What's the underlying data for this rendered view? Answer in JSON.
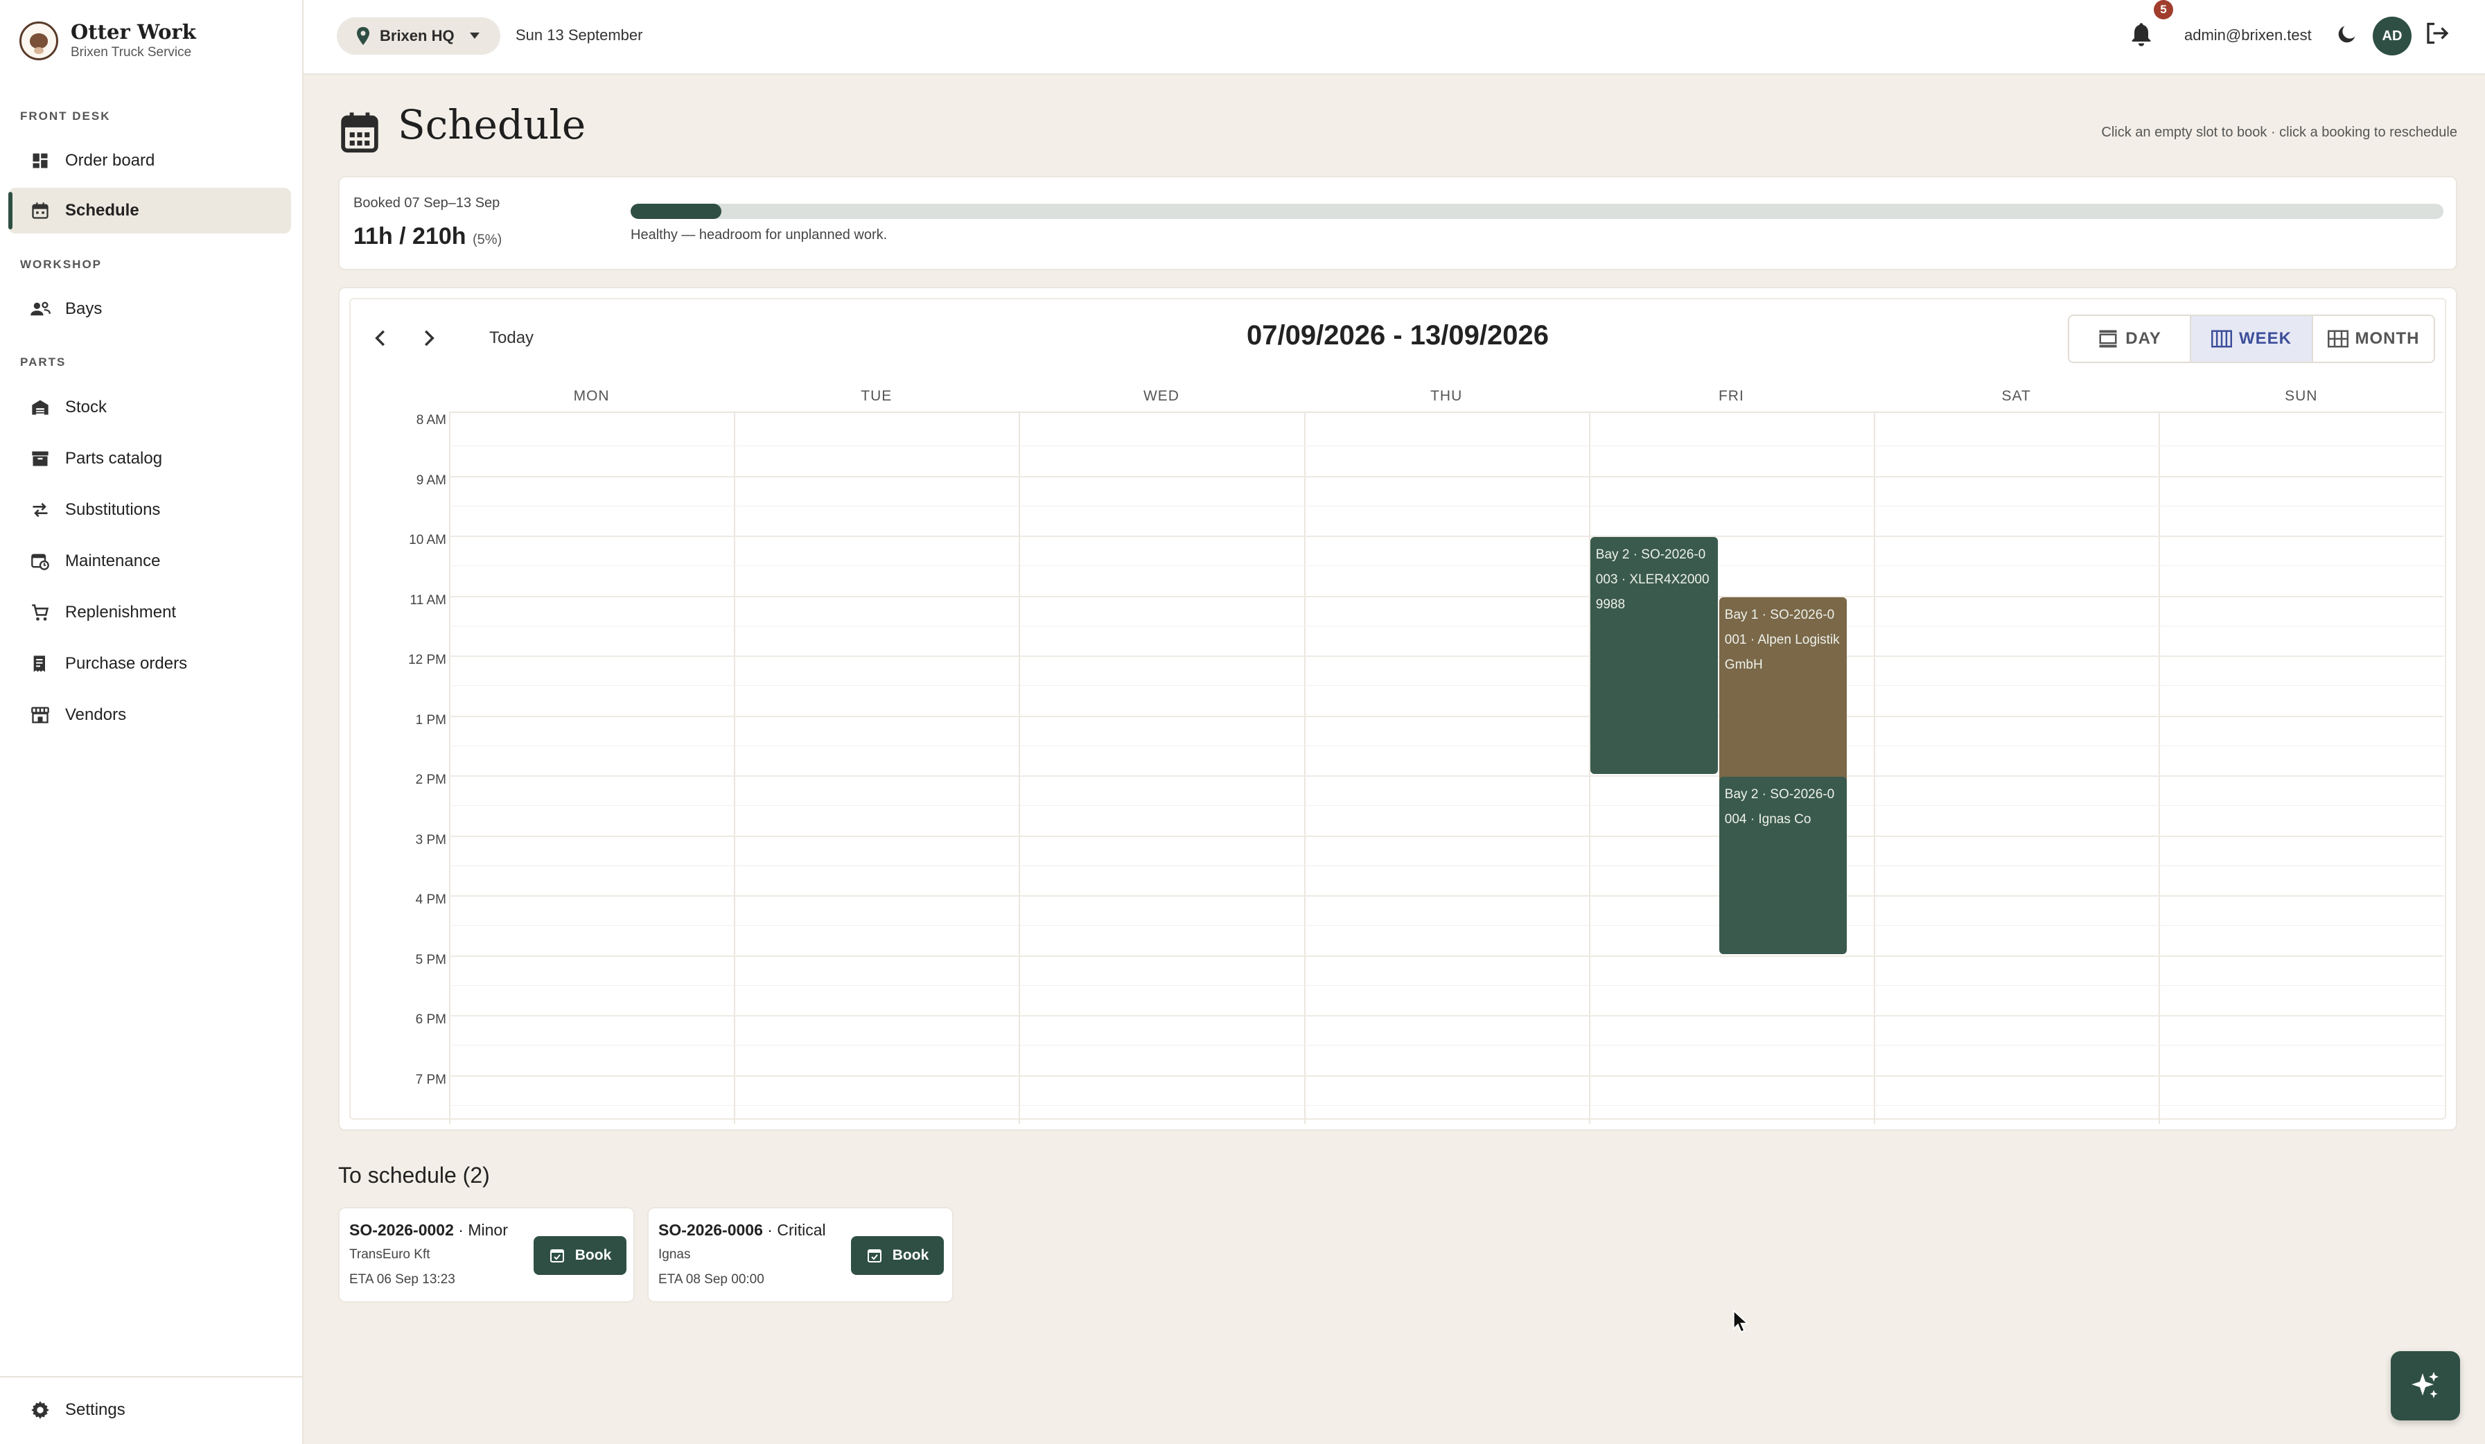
{
  "brand": {
    "title": "Otter Work",
    "subtitle": "Brixen Truck Service"
  },
  "sidebar": {
    "sections": {
      "front_desk": "FRONT DESK",
      "workshop": "WORKSHOP",
      "parts": "PARTS"
    },
    "items": [
      {
        "label": "Order board",
        "icon": "dashboard-icon"
      },
      {
        "label": "Schedule",
        "icon": "calendar-icon",
        "active": true
      },
      {
        "label": "Bays",
        "icon": "users-icon"
      },
      {
        "label": "Stock",
        "icon": "warehouse-icon"
      },
      {
        "label": "Parts catalog",
        "icon": "archive-icon"
      },
      {
        "label": "Substitutions",
        "icon": "swap-icon"
      },
      {
        "label": "Maintenance",
        "icon": "calendar-clock-icon"
      },
      {
        "label": "Replenishment",
        "icon": "cart-icon"
      },
      {
        "label": "Purchase orders",
        "icon": "receipt-icon"
      },
      {
        "label": "Vendors",
        "icon": "store-icon"
      }
    ],
    "settings": "Settings"
  },
  "topbar": {
    "location": "Brixen HQ",
    "date": "Sun 13 September",
    "notifications": "5",
    "email": "admin@brixen.test",
    "avatar": "AD"
  },
  "page": {
    "title": "Schedule",
    "hint": "Click an empty slot to book · click a booking to reschedule"
  },
  "capacity": {
    "label": "Booked 07 Sep–13 Sep",
    "value": "11h / 210h",
    "percent_text": "(5%)",
    "fill_fraction": 0.05,
    "status": "Healthy — headroom for unplanned work."
  },
  "calendar": {
    "today": "Today",
    "range": "07/09/2026 - 13/09/2026",
    "views": [
      "DAY",
      "WEEK",
      "MONTH"
    ],
    "active_view": "WEEK",
    "days": [
      "MON",
      "TUE",
      "WED",
      "THU",
      "FRI",
      "SAT",
      "SUN"
    ],
    "hours": [
      "8 AM",
      "9 AM",
      "10 AM",
      "11 AM",
      "12 PM",
      "1 PM",
      "2 PM",
      "3 PM",
      "4 PM",
      "5 PM",
      "6 PM",
      "7 PM"
    ],
    "bookings": [
      {
        "text": "Bay 2 · SO-2026-0003 · XLER4X20009988",
        "day": "FRI",
        "start": 10,
        "end": 14,
        "color": "#3a5a4d"
      },
      {
        "text": "Bay 1 · SO-2026-0001 · Alpen Logistik GmbH",
        "day": "FRI",
        "start": 11,
        "end": 15,
        "color": "#7a6848"
      },
      {
        "text": "Bay 2 · SO-2026-0004 · Ignas Co",
        "day": "FRI",
        "start": 14,
        "end": 17,
        "color": "#3a5a4d"
      }
    ]
  },
  "to_schedule": {
    "title": "To schedule (2)",
    "items": [
      {
        "id": "SO-2026-0002",
        "priority": "Minor",
        "customer": "TransEuro Kft",
        "eta": "ETA 06 Sep 13:23",
        "button": "Book"
      },
      {
        "id": "SO-2026-0006",
        "priority": "Critical",
        "customer": "Ignas",
        "eta": "ETA 08 Sep 00:00",
        "button": "Book"
      }
    ]
  },
  "colors": {
    "accent": "#2f4f44",
    "brown": "#7a6848",
    "background": "#f3efe8"
  }
}
